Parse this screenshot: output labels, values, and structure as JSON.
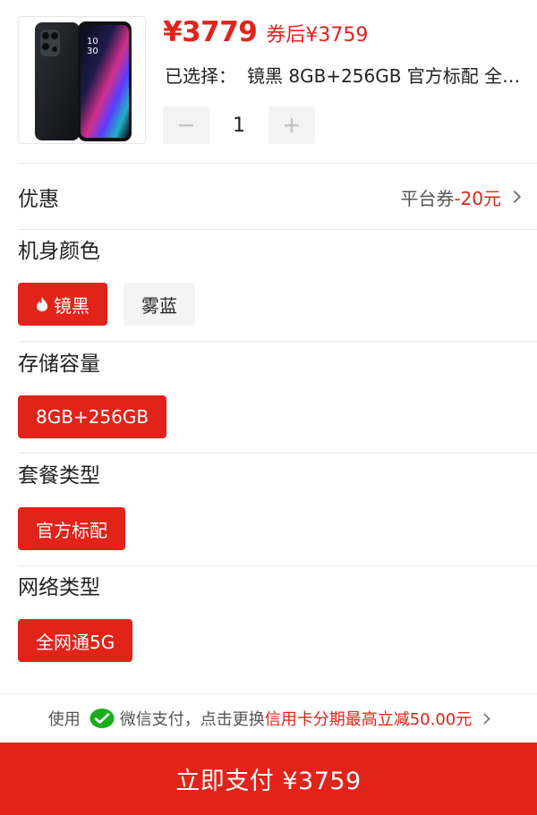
{
  "product": {
    "price": "¥3779",
    "coupon_price": "券后¥3759",
    "selected_prefix": "已选择：",
    "selected_value": "镜黑 8GB+256GB 官方标配 全网通5G",
    "quantity": "1"
  },
  "discount": {
    "title": "优惠",
    "label": "平台券",
    "amount": "-20元"
  },
  "sections": {
    "color": {
      "title": "机身颜色",
      "options": [
        "镜黑",
        "雾蓝"
      ],
      "selected": "镜黑"
    },
    "storage": {
      "title": "存储容量",
      "options": [
        "8GB+256GB"
      ],
      "selected": "8GB+256GB"
    },
    "package": {
      "title": "套餐类型",
      "options": [
        "官方标配"
      ],
      "selected": "官方标配"
    },
    "network": {
      "title": "网络类型",
      "options": [
        "全网通5G"
      ],
      "selected": "全网通5G"
    }
  },
  "payment": {
    "prefix": "使用",
    "method": "微信支付，点击更换",
    "promo": "信用卡分期最高立减50.00元",
    "pay_button": "立即支付 ¥3759"
  },
  "colors": {
    "accent": "#e2231a",
    "chip_bg": "#f3f3f3",
    "wechat": "#1aad19"
  },
  "icons": [
    "phone-product-image",
    "minus-icon",
    "plus-icon",
    "chevron-right-icon",
    "flame-icon",
    "wechat-pay-icon"
  ]
}
